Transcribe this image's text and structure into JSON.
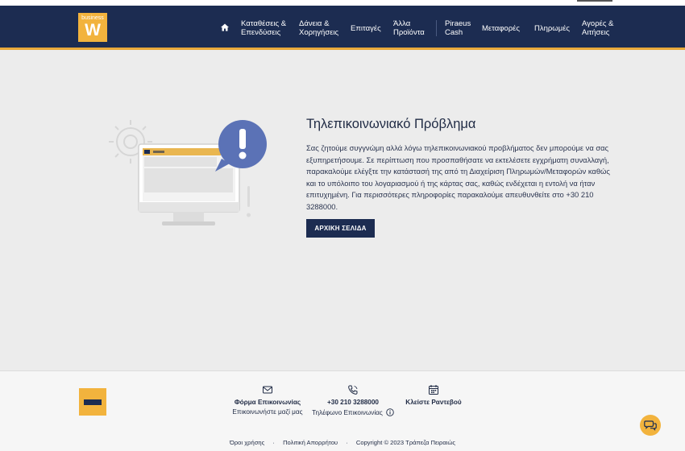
{
  "header": {
    "logo": {
      "top": "business",
      "letter": "W"
    },
    "nav": [
      {
        "id": "home",
        "label": ""
      },
      {
        "id": "deposits",
        "label": "Καταθέσεις &\nΕπενδύσεις"
      },
      {
        "id": "loans",
        "label": "Δάνεια &\nΧορηγήσεις"
      },
      {
        "id": "checks",
        "label": "Επιταγές"
      },
      {
        "id": "other",
        "label": "Άλλα\nΠροϊόντα"
      },
      {
        "id": "cash",
        "label": "Piraeus\nCash"
      },
      {
        "id": "transfers",
        "label": "Μεταφορές"
      },
      {
        "id": "payments",
        "label": "Πληρωμές"
      },
      {
        "id": "purchases",
        "label": "Αγορές &\nΑιτήσεις"
      }
    ]
  },
  "error": {
    "title": "Τηλεπικοινωνιακό Πρόβλημα",
    "message": "Σας ζητούμε συγγνώμη αλλά λόγω τηλεπικοινωνιακού προβλήματος δεν μπορούμε να σας εξυπηρετήσουμε. Σε περίπτωση που προσπαθήσατε να εκτελέσετε εγχρήματη συναλλαγή, παρακαλούμε ελέγξτε την κατάστασή της από τη Διαχείριση Πληρωμών/Μεταφορών καθώς και το υπόλοιπο του λογαριασμού ή της κάρτας σας, καθώς ενδέχεται η εντολή να ήταν επιτυχημένη. Για περισσότερες πληροφορίες παρακαλούμε απευθυνθείτε στο +30 210 3288000.",
    "button": "ΑΡΧΙΚΗ ΣΕΛΙΔΑ"
  },
  "footer": {
    "contact_form": {
      "title": "Φόρμα Επικοινωνίας",
      "subtitle": "Επικοινωνήστε μαζί μας"
    },
    "phone": {
      "title": "+30 210 3288000",
      "subtitle": "Τηλέφωνο Επικοινωνίας"
    },
    "appointment": {
      "title": "Κλείστε Ραντεβού"
    },
    "legal": {
      "terms": "Όροι χρήσης",
      "privacy": "Πολιτική Απορρήτου",
      "copyright": "Copyright © 2023 Τράπεζα Πειραιώς"
    }
  },
  "colors": {
    "navy": "#1c2c51",
    "gold": "#f2b33d",
    "bg": "#ececec"
  },
  "icons": [
    "home-icon",
    "envelope-icon",
    "phone-icon",
    "calendar-icon",
    "info-icon",
    "chat-icon",
    "exclamation-bubble-icon",
    "gear-icon",
    "monitor-icon"
  ]
}
